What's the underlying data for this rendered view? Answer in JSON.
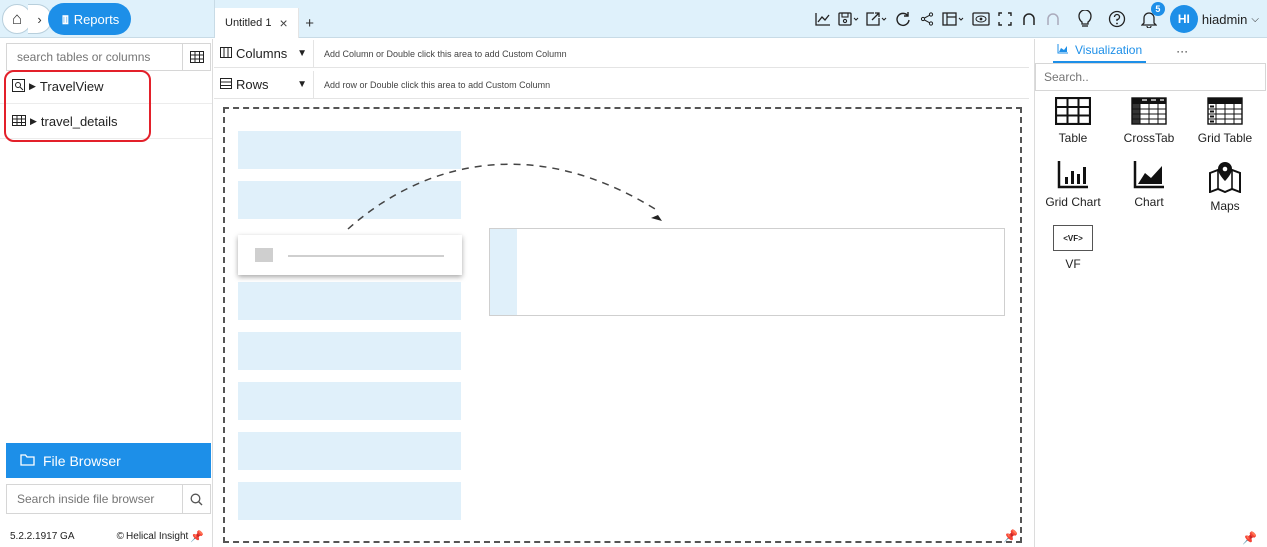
{
  "header": {
    "breadcrumb_reports": "Reports",
    "tab_title": "Untitled 1",
    "tab_close": "×",
    "tab_add": "+",
    "notification_count": "5",
    "user_initials": "HI",
    "user_name": "hiadmin"
  },
  "left_panel": {
    "search_placeholder": "search tables or columns",
    "items": [
      {
        "label": "TravelView",
        "icon": "view-icon"
      },
      {
        "label": "travel_details",
        "icon": "table-icon"
      }
    ],
    "file_browser_label": "File Browser",
    "file_search_placeholder": "Search inside file browser",
    "version": "5.2.2.1917 GA",
    "brand": "Helical Insight"
  },
  "shelves": {
    "columns_label": "Columns",
    "columns_hint": "Add Column or Double click this area to add Custom Column",
    "rows_label": "Rows",
    "rows_hint": "Add row or Double click this area to add Custom Column"
  },
  "right_panel": {
    "tab_label": "Visualization",
    "more_label": "···",
    "search_placeholder": "Search..",
    "visualizations": [
      {
        "label": "Table",
        "icon": "table-viz-icon"
      },
      {
        "label": "CrossTab",
        "icon": "crosstab-icon"
      },
      {
        "label": "Grid Table",
        "icon": "grid-table-icon"
      },
      {
        "label": "Grid Chart",
        "icon": "grid-chart-icon"
      },
      {
        "label": "Chart",
        "icon": "area-chart-icon"
      },
      {
        "label": "Maps",
        "icon": "map-icon"
      },
      {
        "label": "VF",
        "icon": "vf-icon"
      }
    ],
    "vf_glyph": "<VF>"
  },
  "colors": {
    "accent": "#1d8fe8",
    "topbar_bg": "#dff1fb",
    "placeholder_bg": "#e0f0fa",
    "highlight": "#e3202a"
  }
}
